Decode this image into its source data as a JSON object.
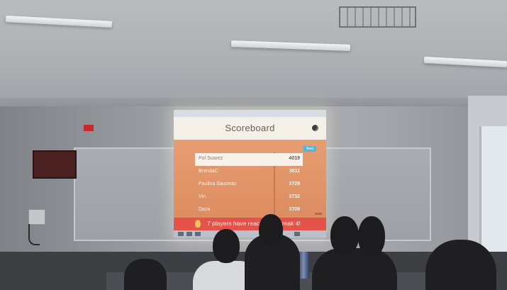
{
  "scoreboard": {
    "title": "Scoreboard",
    "next_label": "Next",
    "players": [
      {
        "name": "Pol Suarez",
        "score": "4019",
        "leader": true
      },
      {
        "name": "BrendaC",
        "score": "3811",
        "leader": false
      },
      {
        "name": "Paulina Saucedo",
        "score": "3729",
        "leader": false
      },
      {
        "name": "Vin",
        "score": "3732",
        "leader": false
      },
      {
        "name": "Daza",
        "score": "3709",
        "leader": false
      }
    ],
    "streak_banner": "7 players have reached a Streak 4!"
  },
  "colors": {
    "screen": "#e8a27a",
    "header": "#f4f0e8",
    "banner": "#e3534a",
    "next_button": "#4fb6d9"
  },
  "icons": [
    "globe-icon",
    "flame-icon",
    "projector-icon"
  ]
}
